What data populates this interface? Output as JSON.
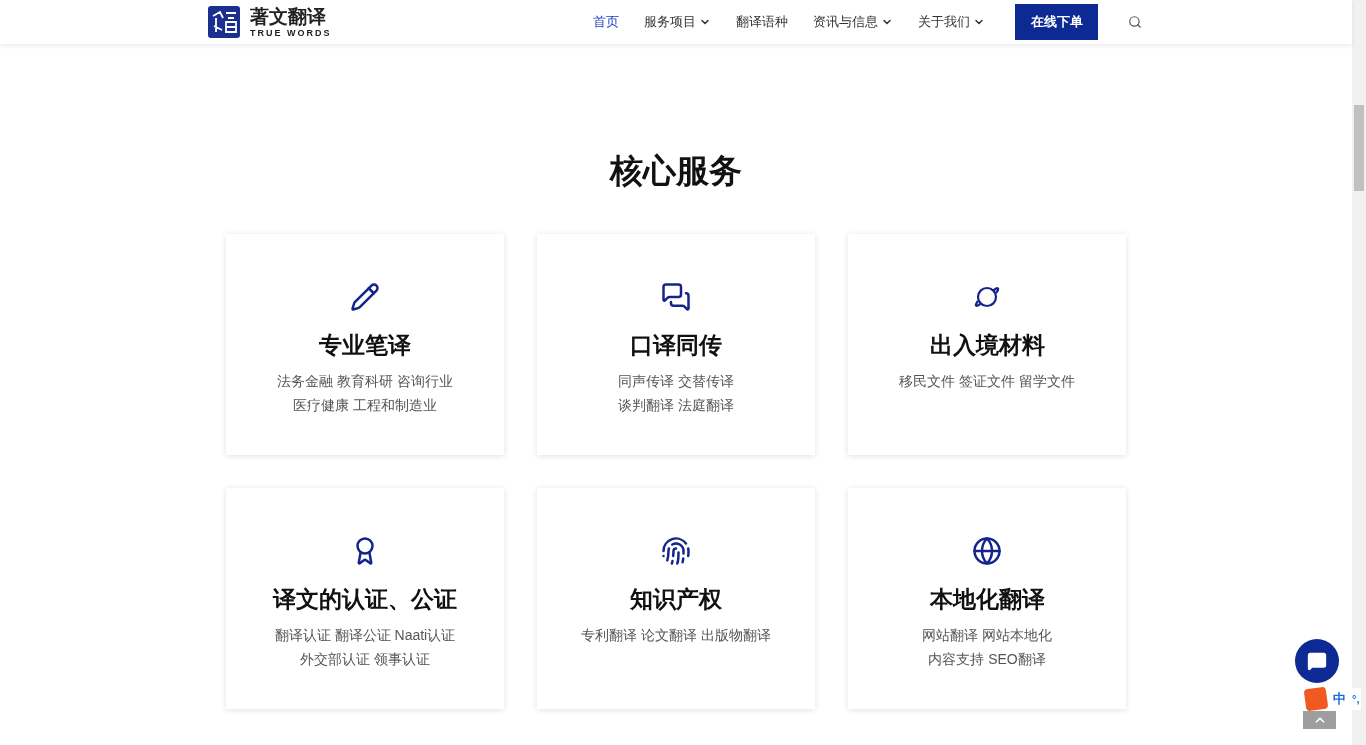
{
  "header": {
    "logo_name": "著文翻译",
    "logo_tagline": "TRUE WORDS",
    "nav": [
      {
        "label": "首页",
        "selected": true,
        "dropdown": false
      },
      {
        "label": "服务项目",
        "selected": false,
        "dropdown": true
      },
      {
        "label": "翻译语种",
        "selected": false,
        "dropdown": false
      },
      {
        "label": "资讯与信息",
        "selected": false,
        "dropdown": true
      },
      {
        "label": "关于我们",
        "selected": false,
        "dropdown": true
      }
    ],
    "cta": "在线下单"
  },
  "section": {
    "title": "核心服务",
    "cards": [
      {
        "kind": "pencil",
        "title": "专业笔译",
        "lines": [
          "法务金融 教育科研 咨询行业",
          "医疗健康 工程和制造业"
        ]
      },
      {
        "kind": "chat",
        "title": "口译同传",
        "lines": [
          "同声传译 交替传译",
          "谈判翻译 法庭翻译"
        ]
      },
      {
        "kind": "planet",
        "title": "出入境材料",
        "lines": [
          "移民文件 签证文件 留学文件"
        ]
      },
      {
        "kind": "award",
        "title": "译文的认证、公证",
        "lines": [
          "翻译认证 翻译公证 Naati认证",
          "外交部认证 领事认证"
        ]
      },
      {
        "kind": "fingerprint",
        "title": "知识产权",
        "lines": [
          "专利翻译 论文翻译 出版物翻译"
        ]
      },
      {
        "kind": "globe",
        "title": "本地化翻译",
        "lines": [
          "网站翻译 网站本地化",
          "内容支持 SEO翻译"
        ]
      }
    ]
  },
  "ime": {
    "mode": "中",
    "punct": "°,"
  }
}
